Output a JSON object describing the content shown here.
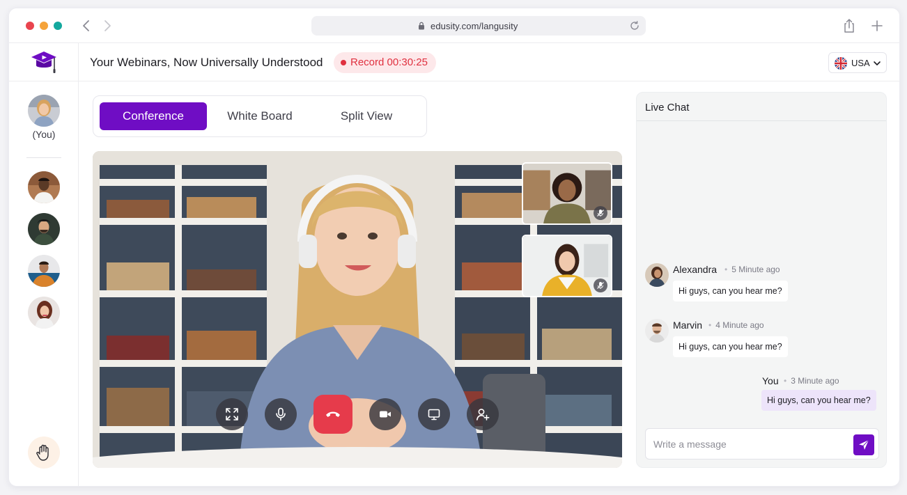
{
  "browser": {
    "url": "edusity.com/langusity"
  },
  "header": {
    "title": "Your Webinars, Now Universally Understood",
    "record_label": "Record 00:30:25",
    "language": "USA"
  },
  "sidebar": {
    "you_label": "(You)"
  },
  "tabs": [
    {
      "label": "Conference",
      "active": true
    },
    {
      "label": "White Board",
      "active": false
    },
    {
      "label": "Split View",
      "active": false
    }
  ],
  "controls": [
    "fullscreen-icon",
    "microphone-icon",
    "end-call-icon",
    "camera-icon",
    "screen-share-icon",
    "add-participant-icon"
  ],
  "chat": {
    "title": "Live Chat",
    "messages": [
      {
        "name": "Alexandra",
        "time": "5 Minute ago",
        "text": "Hi guys, can you hear me?"
      },
      {
        "name": "Marvin",
        "time": "4 Minute ago",
        "text": "Hi guys, can you hear me?"
      },
      {
        "name": "You",
        "time": "3 Minute ago",
        "text": "Hi guys, can you hear me?"
      }
    ],
    "input_placeholder": "Write a message"
  },
  "colors": {
    "accent": "#6f0dc4",
    "record": "#e0303f",
    "end_call": "#e63b4b",
    "chat_bg": "#f4f5f5",
    "own_bubble": "#ede4fa"
  }
}
